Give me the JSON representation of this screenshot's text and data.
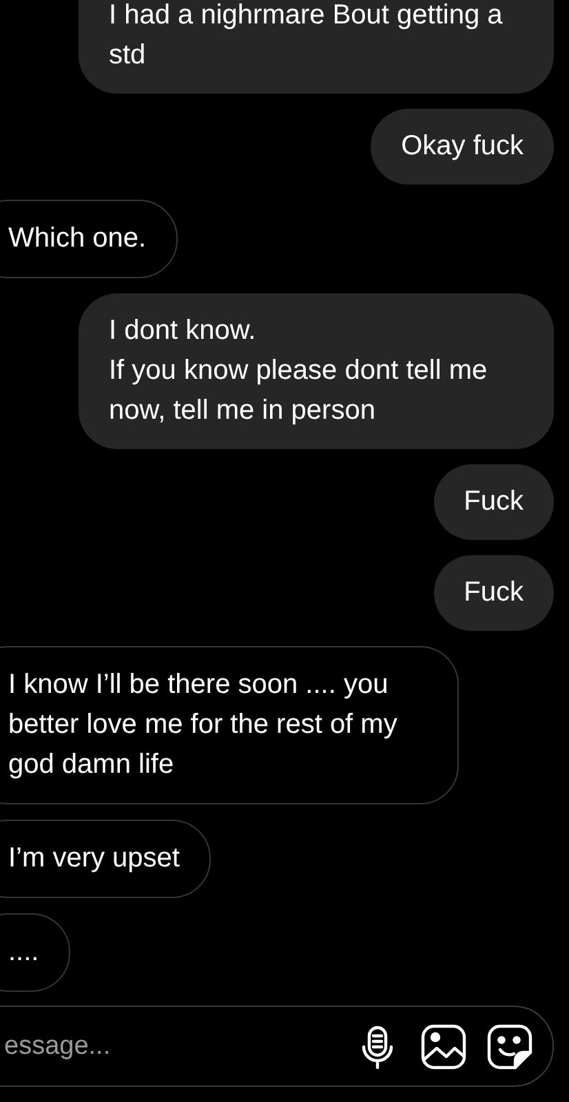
{
  "messages": [
    {
      "kind": "sent",
      "text": "I had a nighrmare Bout getting a std"
    },
    {
      "kind": "sent",
      "text": "Okay fuck"
    },
    {
      "kind": "received",
      "text": "Which one."
    },
    {
      "kind": "sent",
      "text": "I dont know.\nIf you know please dont tell me now, tell me in person"
    },
    {
      "kind": "sent",
      "text": "Fuck"
    },
    {
      "kind": "sent",
      "text": "Fuck"
    },
    {
      "kind": "received",
      "text": "I know I’ll be there soon .... you better love me for the rest of my god damn life"
    },
    {
      "kind": "received",
      "text": "I’m very upset"
    },
    {
      "kind": "received",
      "text": "...."
    }
  ],
  "composer": {
    "placeholder": "essage..."
  }
}
